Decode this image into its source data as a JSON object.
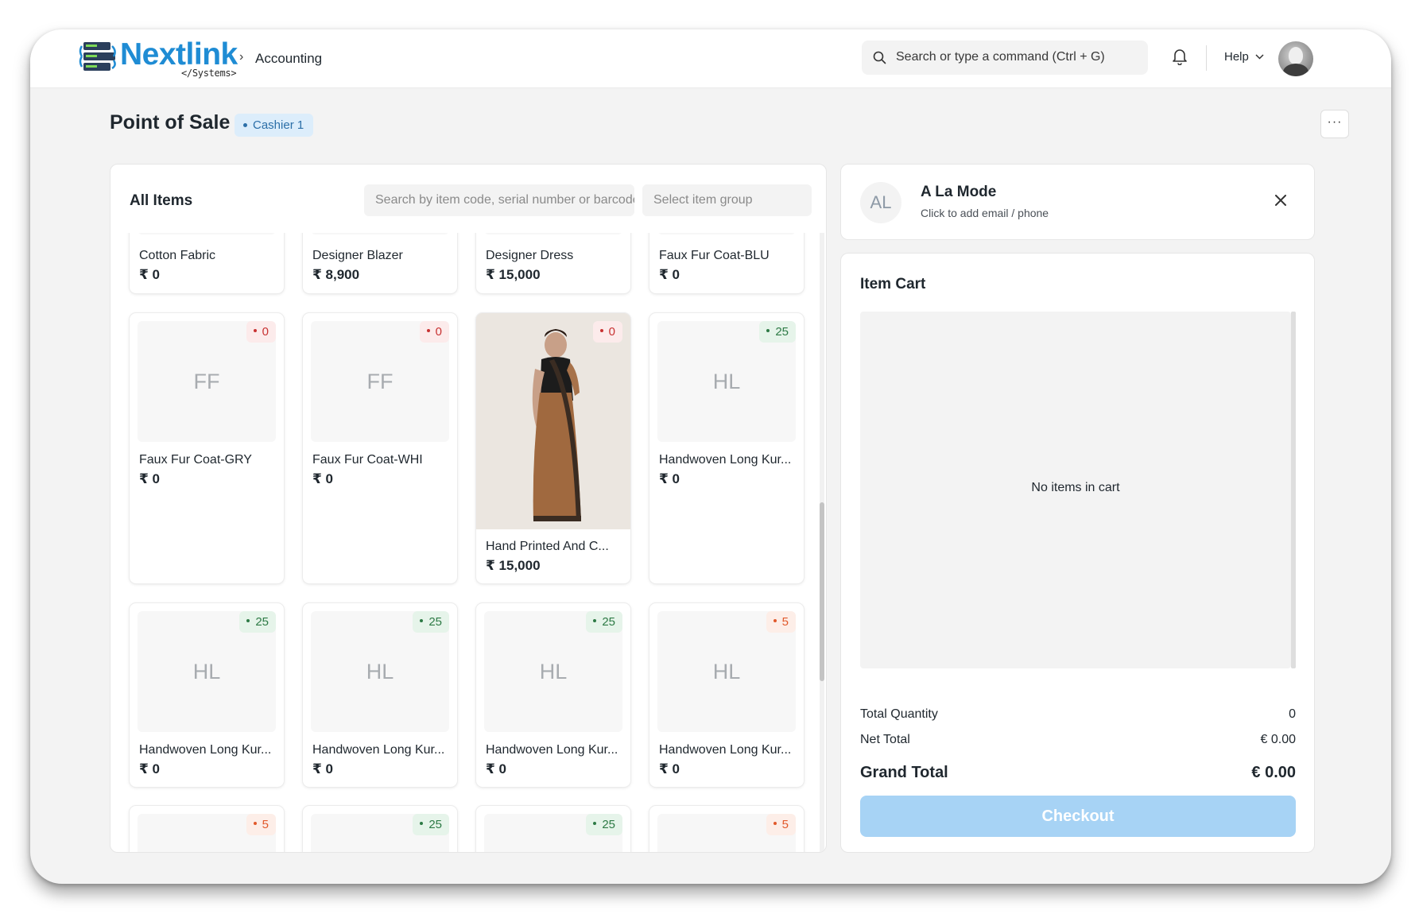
{
  "navbar": {
    "logo_text": "Nextlink",
    "logo_subtext": "</Systems>",
    "breadcrumb_separator": "›",
    "breadcrumb": "Accounting",
    "search_placeholder": "Search or type a command (Ctrl + G)",
    "help_label": "Help"
  },
  "page": {
    "title": "Point of Sale",
    "cashier_badge": "Cashier 1",
    "more_button": "···"
  },
  "items": {
    "title": "All Items",
    "search_placeholder": "Search by item code, serial number or barcode",
    "group_placeholder": "Select item group",
    "list": [
      {
        "name": "Cotton Fabric",
        "price": "₹ 0",
        "initials": "",
        "stock": "",
        "stock_color": "",
        "partial": "top"
      },
      {
        "name": "Designer Blazer",
        "price": "₹ 8,900",
        "initials": "",
        "stock": "",
        "stock_color": "",
        "partial": "top"
      },
      {
        "name": "Designer Dress",
        "price": "₹ 15,000",
        "initials": "",
        "stock": "",
        "stock_color": "",
        "partial": "top"
      },
      {
        "name": "Faux Fur Coat-BLU",
        "price": "₹ 0",
        "initials": "",
        "stock": "",
        "stock_color": "",
        "partial": "top"
      },
      {
        "name": "Faux Fur Coat-GRY",
        "price": "₹ 0",
        "initials": "FF",
        "stock": "0",
        "stock_color": "red"
      },
      {
        "name": "Faux Fur Coat-WHI",
        "price": "₹ 0",
        "initials": "FF",
        "stock": "0",
        "stock_color": "red"
      },
      {
        "name": "Hand Printed And C...",
        "price": "₹ 15,000",
        "initials": "",
        "stock": "0",
        "stock_color": "red",
        "photo": true
      },
      {
        "name": "Handwoven Long Kur...",
        "price": "₹ 0",
        "initials": "HL",
        "stock": "25",
        "stock_color": "green"
      },
      {
        "name": "Handwoven Long Kur...",
        "price": "₹ 0",
        "initials": "HL",
        "stock": "25",
        "stock_color": "green"
      },
      {
        "name": "Handwoven Long Kur...",
        "price": "₹ 0",
        "initials": "HL",
        "stock": "25",
        "stock_color": "green"
      },
      {
        "name": "Handwoven Long Kur...",
        "price": "₹ 0",
        "initials": "HL",
        "stock": "25",
        "stock_color": "green"
      },
      {
        "name": "Handwoven Long Kur...",
        "price": "₹ 0",
        "initials": "HL",
        "stock": "5",
        "stock_color": "orange"
      },
      {
        "name": "",
        "price": "",
        "initials": "",
        "stock": "5",
        "stock_color": "orange",
        "partial": "bottom"
      },
      {
        "name": "",
        "price": "",
        "initials": "",
        "stock": "25",
        "stock_color": "green",
        "partial": "bottom"
      },
      {
        "name": "",
        "price": "",
        "initials": "",
        "stock": "25",
        "stock_color": "green",
        "partial": "bottom"
      },
      {
        "name": "",
        "price": "",
        "initials": "",
        "stock": "5",
        "stock_color": "orange",
        "partial": "bottom"
      }
    ]
  },
  "customer": {
    "initials": "AL",
    "name": "A La Mode",
    "subtitle": "Click to add email / phone"
  },
  "cart": {
    "title": "Item Cart",
    "empty_text": "No items in cart",
    "total_quantity_label": "Total Quantity",
    "total_quantity_value": "0",
    "net_total_label": "Net Total",
    "net_total_value": "€ 0.00",
    "grand_total_label": "Grand Total",
    "grand_total_value": "€ 0.00",
    "checkout_label": "Checkout"
  },
  "colors": {
    "brand": "#1f8cd4",
    "checkout_disabled": "#a7d3f5",
    "stock_red": "#c83232",
    "stock_green": "#2d7a45",
    "stock_orange": "#e1592b"
  }
}
